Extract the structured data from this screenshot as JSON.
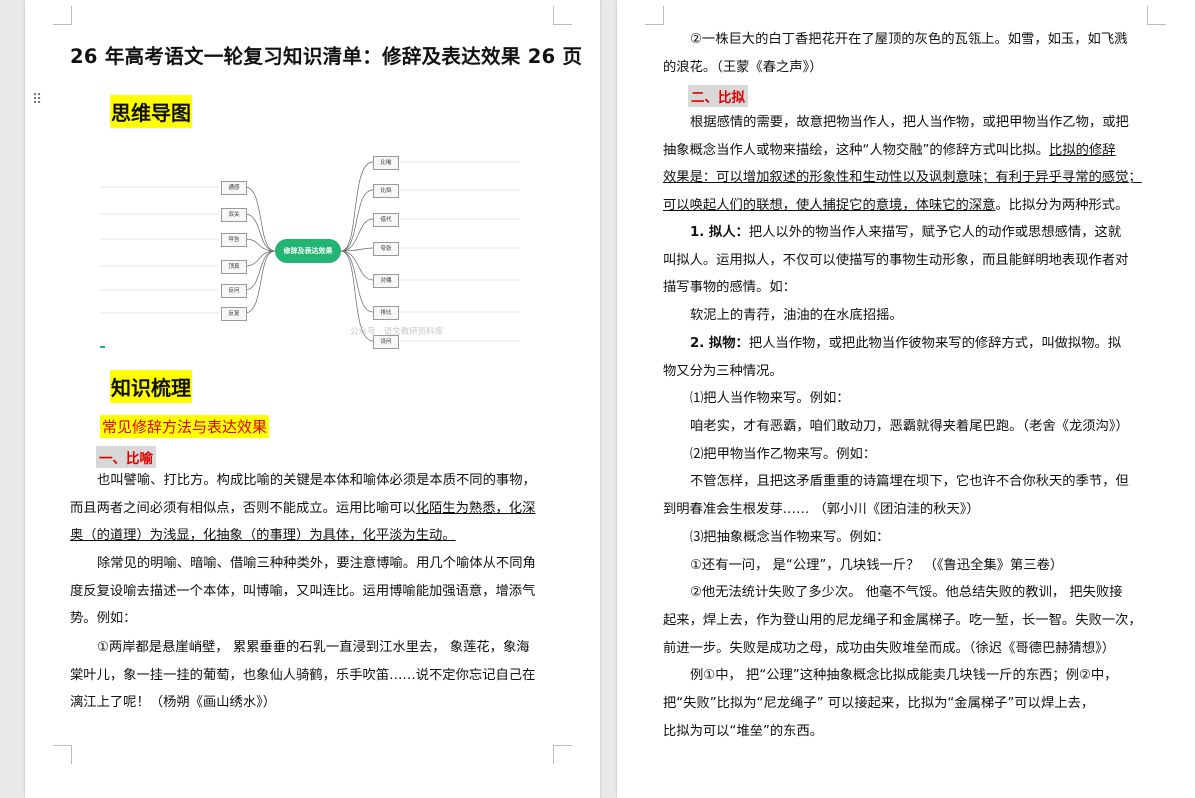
{
  "left_page": {
    "title": "26 年高考语文一轮复习知识清单：修辞及表达效果 26 页",
    "drag_handle": "⠿",
    "mindmap_heading": "思维导图",
    "mindmap": {
      "center": "修辞及表达效果",
      "right_nodes": [
        "比喻",
        "比拟",
        "借代",
        "夸张",
        "对偶",
        "排比",
        "设问"
      ],
      "left_nodes": [
        "通感",
        "双关",
        "呼告",
        "顶真",
        "反问",
        "反复"
      ],
      "watermark": "公众号 · 语文教研资料库"
    },
    "section_heading": "知识梳理",
    "sub_heading": "常见修辞方法与表达效果",
    "bilyu_heading": "一、比喻",
    "p1_lines": [
      [
        "也叫譬喻、打比方。构成比喻的关键是本体和喻体必须是本质不同的事物，"
      ],
      [
        "而且两者之间必须有相似点，否则不能成立。运用比喻可以",
        "化陌生为熟悉，化深"
      ],
      [
        "奥（的道理）为浅显，化抽象（的事理）为具体，化平淡为生动。"
      ]
    ],
    "p2_lines": [
      "除常见的明喻、暗喻、借喻三种种类外，要注意博喻。用几个喻体从不同角",
      "度反复设喻去描述一个本体，叫博喻，又叫连比。运用博喻能加强语意，增添气",
      "势。例如："
    ],
    "p3_lines": [
      "①两岸都是悬崖峭壁， 累累垂垂的石乳一直浸到江水里去， 象莲花，象海",
      "棠叶儿，象一挂一挂的葡萄，也象仙人骑鹤，乐手吹笛……说不定你忘记自己在",
      "漓江上了呢！（杨朔《画山绣水》）"
    ]
  },
  "right_page": {
    "p0_lines": [
      "②一株巨大的白丁香把花开在了屋顶的灰色的瓦瓴上。如雪，如玉，如飞溅",
      "的浪花。（王蒙《春之声》）"
    ],
    "bini_heading": "二、比拟",
    "p1_lines": [
      [
        "根据感情的需要，故意把物当作人，把人当作物，或把甲物当作乙物，或把"
      ],
      [
        "抽象概念当作人或物来描绘，这种“人物交融”的修辞方式叫比拟。",
        "比拟的修辞"
      ],
      [
        "",
        "效果是：可以增加叙述的形象性和生动性以及讽刺意味；有利于异乎寻常的感觉；"
      ],
      [
        "",
        "可以唤起人们的联想，使人捕捉它的意境，体味它的深意",
        "。比拟分为两种形式。"
      ]
    ],
    "nihua_label": "1. 拟人：",
    "nihua_lines": [
      "把人以外的物当作人来描写，赋予它人的动作或思想感情，这就",
      "叫拟人。运用拟人，不仅可以使描写的事物生动形象，而且能鲜明地表现作者对",
      "描写事物的感情。如："
    ],
    "nihua_example": "软泥上的青荇，油油的在水底招摇。",
    "niwu_label": "2. 拟物：",
    "niwu_lines": [
      "把人当作物，或把此物当作彼物来写的修辞方式，叫做拟物。拟",
      "物又分为三种情况。"
    ],
    "case1_title": "⑴把人当作物来写。例如：",
    "case1_example": "咱老实，才有恶霸，咱们敢动刀，恶霸就得夹着尾巴跑。（老舍《龙须沟》）",
    "case2_title": "⑵把甲物当作乙物来写。例如：",
    "case2_lines": [
      "不管怎样，且把这矛盾重重的诗篇埋在坝下，它也许不合你秋天的季节，但",
      "到明春准会生根发芽……        （郭小川《团泊洼的秋天》）"
    ],
    "case3_title": "⑶把抽象概念当作物来写。例如：",
    "case3_ex1": "①还有一问，  是“公理”，几块钱一斤？          （《鲁迅全集》第三卷）",
    "case3_ex2_lines": [
      "②他无法统计失败了多少次。  他毫不气馁。他总结失败的教训，  把失败接",
      "起来，焊上去，作为登山用的尼龙绳子和金属梯子。吃一堑，长一智。失败一次，",
      "前进一步。失败是成功之母，成功由失败堆垒而成。（徐迟《哥德巴赫猜想》）"
    ],
    "analysis_lines": [
      "例①中，  把“公理”这种抽象概念比拟成能卖几块钱一斤的东西；例②中，",
      "把“失败”比拟为“尼龙绳子” 可以接起来，比拟为“金属梯子”可以焊上去，",
      "比拟为可以“堆垒”的东西。"
    ]
  }
}
